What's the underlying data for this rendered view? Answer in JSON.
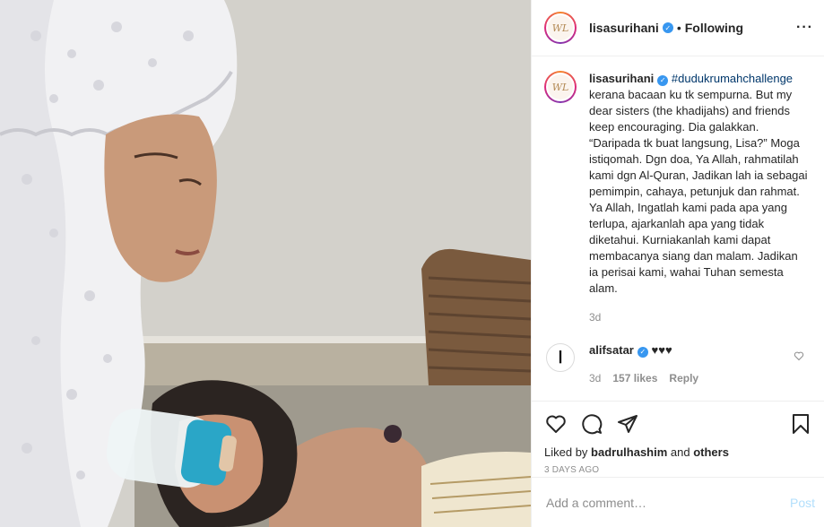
{
  "header": {
    "username": "lisasurihani",
    "verified": true,
    "separator": "•",
    "follow_label": "Following",
    "more_label": "···",
    "avatar_initials": "WL"
  },
  "caption": {
    "username": "lisasurihani",
    "hashtag": "#dudukrumahchallenge",
    "text": " kerana bacaan ku tk sempurna. But my dear sisters (the khadijahs) and friends keep encouraging. Dia galakkan. “Daripada tk buat langsung, Lisa?” Moga istiqomah. Dgn doa, Ya Allah, rahmatilah kami dgn Al-Quran, Jadikan lah ia sebagai pemimpin, cahaya, petunjuk dan rahmat. Ya Allah, Ingatlah kami pada apa yang terlupa, ajarkanlah apa yang tidak diketahui. Kurniakanlah kami dapat membacanya siang dan malam. Jadikan ia perisai kami, wahai Tuhan semesta alam.",
    "time": "3d"
  },
  "comment": {
    "username": "alifsatar",
    "avatar_glyph": "ا",
    "text": "♥♥♥",
    "time": "3d",
    "likes": "157 likes",
    "reply_label": "Reply"
  },
  "actions": {
    "icons": [
      "heart-icon",
      "comment-icon",
      "share-icon",
      "bookmark-icon"
    ]
  },
  "likes": {
    "prefix": "Liked by ",
    "user": "badrulhashim",
    "middle": " and ",
    "others": "others"
  },
  "timestamp": "3 DAYS AGO",
  "add_comment": {
    "placeholder": "Add a comment…",
    "post_label": "Post"
  },
  "colors": {
    "link": "#00376b",
    "verified": "#3897f0",
    "muted": "#8e8e8e",
    "post_disabled": "#b2dffc"
  }
}
